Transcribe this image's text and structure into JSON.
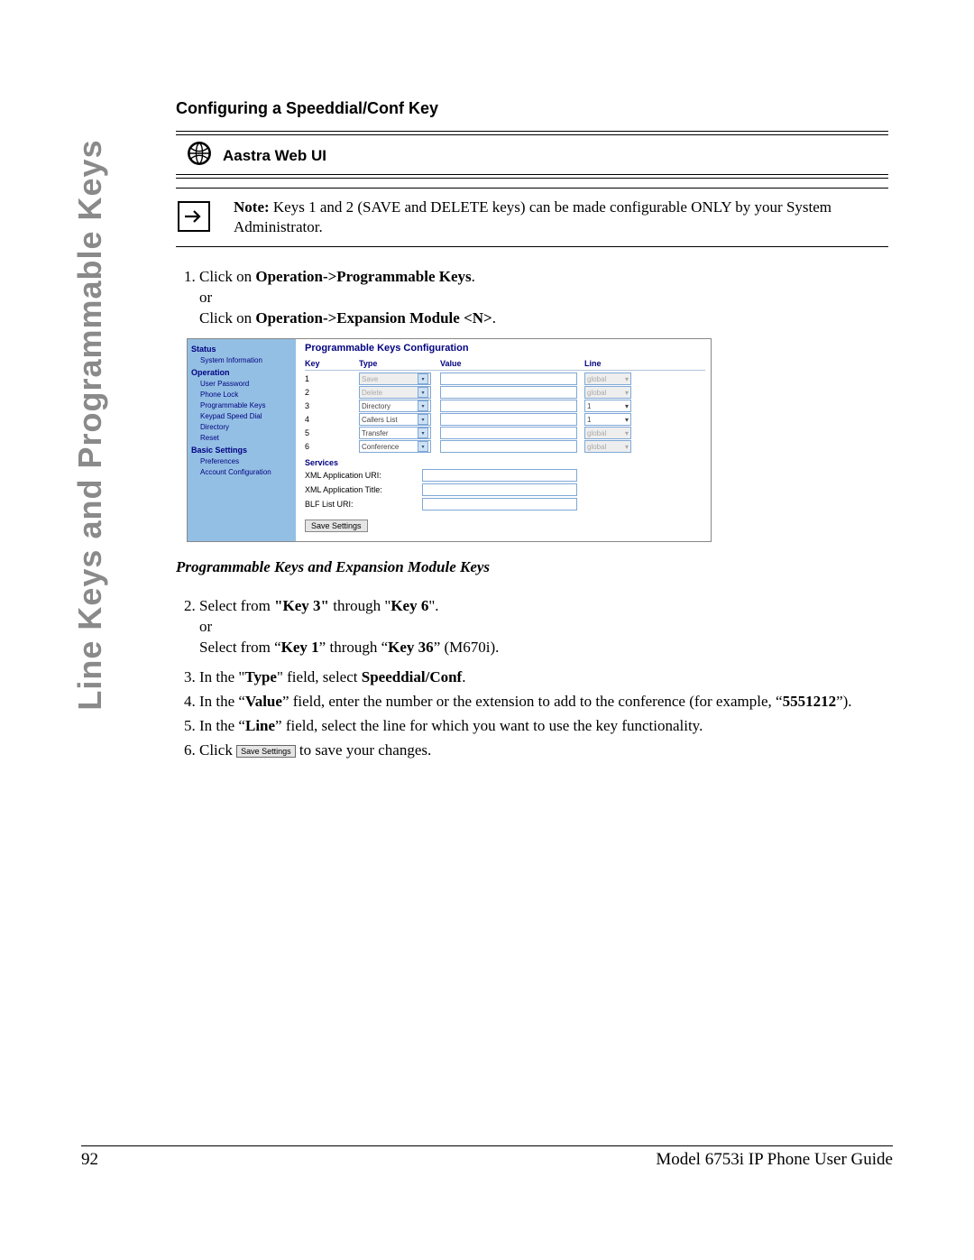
{
  "side_label": "Line Keys and Programmable Keys",
  "title": "Configuring a Speeddial/Conf Key",
  "web_ui_label": "Aastra Web UI",
  "note_prefix": "Note:",
  "note_text": " Keys 1 and 2 (SAVE and DELETE keys) can be made configurable ONLY by your System Administrator.",
  "step1_a": "Click on ",
  "step1_b": "Operation->Programmable Keys",
  "step1_c": ".",
  "step1_or": "or",
  "step1_d": "Click on ",
  "step1_e": "Operation->Expansion Module <N>",
  "step1_f": ".",
  "mock": {
    "title": "Programmable Keys Configuration",
    "headers": {
      "key": "Key",
      "type": "Type",
      "value": "Value",
      "line": "Line"
    },
    "nav": {
      "status": "Status",
      "sysinfo": "System Information",
      "operation": "Operation",
      "items_op": [
        "User Password",
        "Phone Lock",
        "Programmable Keys",
        "Keypad Speed Dial",
        "Directory",
        "Reset"
      ],
      "basic": "Basic Settings",
      "items_bs": [
        "Preferences",
        "Account Configuration"
      ]
    },
    "rows": [
      {
        "key": "1",
        "type": "Save",
        "disabled": true,
        "line": "global",
        "line_disabled": true
      },
      {
        "key": "2",
        "type": "Delete",
        "disabled": true,
        "line": "global",
        "line_disabled": true
      },
      {
        "key": "3",
        "type": "Directory",
        "disabled": false,
        "line": "1",
        "line_disabled": false
      },
      {
        "key": "4",
        "type": "Callers List",
        "disabled": false,
        "line": "1",
        "line_disabled": false
      },
      {
        "key": "5",
        "type": "Transfer",
        "disabled": false,
        "line": "global",
        "line_disabled": true
      },
      {
        "key": "6",
        "type": "Conference",
        "disabled": false,
        "line": "global",
        "line_disabled": true
      }
    ],
    "services_label": "Services",
    "svc1": "XML Application URI:",
    "svc2": "XML Application Title:",
    "svc3": "BLF List URI:",
    "save_btn": "Save Settings"
  },
  "subheading": "Programmable Keys and Expansion Module Keys",
  "step2_html": [
    "Select from ",
    "\"Key 3\"",
    " through \"",
    "Key 6",
    "\".",
    "or",
    "Select from “",
    "Key 1",
    "” through “",
    "Key 36",
    "” (M670i)."
  ],
  "step3": [
    "In the \"",
    "Type",
    "\" field, select ",
    "Speeddial/Conf",
    "."
  ],
  "step4": [
    "In the “",
    "Value",
    "” field, enter the number or the extension to add to the conference (for example, “",
    "5551212",
    "”)."
  ],
  "step5": [
    "In the “",
    "Line",
    "” field, select the line for which you want to use the key functionality."
  ],
  "step6_a": "Click ",
  "step6_btn": "Save Settings",
  "step6_b": " to save your changes.",
  "footer_page": "92",
  "footer_doc": "Model 6753i IP Phone User Guide"
}
